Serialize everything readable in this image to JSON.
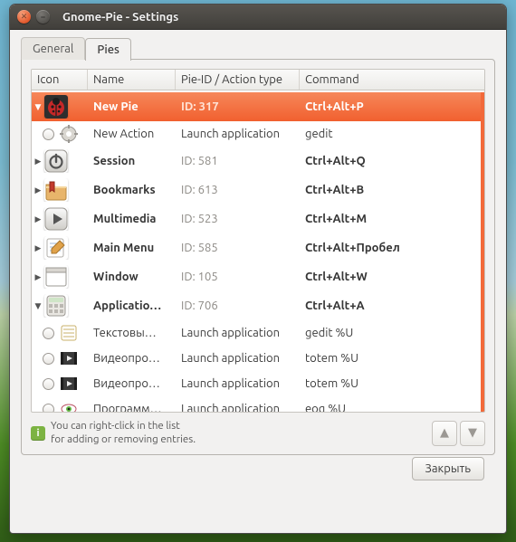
{
  "window": {
    "title": "Gnome-Pie - Settings"
  },
  "tabs": {
    "general": "General",
    "pies": "Pies",
    "active": "pies"
  },
  "columns": {
    "icon": "Icon",
    "name": "Name",
    "type": "Pie-ID / Action type",
    "command": "Command"
  },
  "rows": [
    {
      "kind": "pie",
      "expander": "down",
      "selected": true,
      "name": "New Pie",
      "type": "ID: 317",
      "command": "Ctrl+Alt+P",
      "icon": "ladybug"
    },
    {
      "kind": "action",
      "name": "New Action",
      "type": "Launch application",
      "command": "gedit",
      "icon": "gear"
    },
    {
      "kind": "pie",
      "expander": "right",
      "name": "Session",
      "type": "ID: 581",
      "command": "Ctrl+Alt+Q",
      "icon": "power"
    },
    {
      "kind": "pie",
      "expander": "right",
      "name": "Bookmarks",
      "type": "ID: 613",
      "command": "Ctrl+Alt+B",
      "icon": "folder-bookmark"
    },
    {
      "kind": "pie",
      "expander": "right",
      "name": "Multimedia",
      "type": "ID: 523",
      "command": "Ctrl+Alt+M",
      "icon": "play"
    },
    {
      "kind": "pie",
      "expander": "right",
      "name": "Main Menu",
      "type": "ID: 585",
      "command": "Ctrl+Alt+Пробел",
      "icon": "notepad-pencil"
    },
    {
      "kind": "pie",
      "expander": "right",
      "name": "Window",
      "type": "ID: 105",
      "command": "Ctrl+Alt+W",
      "icon": "window"
    },
    {
      "kind": "pie",
      "expander": "down",
      "name": "Applicatio…",
      "type": "ID: 706",
      "command": "Ctrl+Alt+A",
      "icon": "calculator"
    },
    {
      "kind": "action",
      "name": "Текстовы…",
      "type": "Launch application",
      "command": "gedit %U",
      "icon": "notepad-lines"
    },
    {
      "kind": "action",
      "name": "Видеопро…",
      "type": "Launch application",
      "command": "totem %U",
      "icon": "video"
    },
    {
      "kind": "action",
      "name": "Видеопро…",
      "type": "Launch application",
      "command": "totem %U",
      "icon": "video"
    },
    {
      "kind": "action",
      "name": "Программ…",
      "type": "Launch application",
      "command": "eog %U",
      "icon": "eye"
    }
  ],
  "hint": {
    "line1": "You can right-click in the list",
    "line2": "for adding or removing entries."
  },
  "buttons": {
    "close": "Закрыть"
  }
}
